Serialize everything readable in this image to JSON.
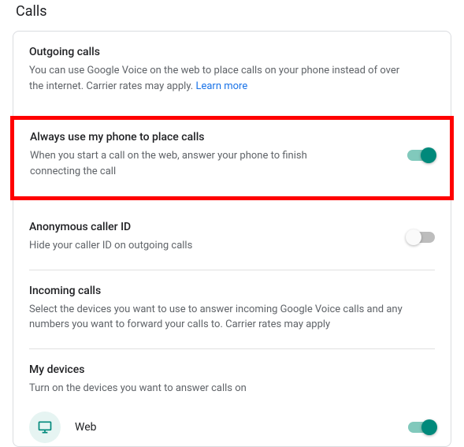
{
  "page_title": "Calls",
  "outgoing": {
    "title": "Outgoing calls",
    "desc": "You can use Google Voice on the web to place calls on your phone instead of over the internet. Carrier rates may apply. ",
    "learn_more": "Learn more"
  },
  "always_phone": {
    "title": "Always use my phone to place calls",
    "desc": "When you start a call on the web, answer your phone to finish connecting the call",
    "enabled": true
  },
  "anonymous": {
    "title": "Anonymous caller ID",
    "desc": "Hide your caller ID on outgoing calls",
    "enabled": false
  },
  "incoming": {
    "title": "Incoming calls",
    "desc": "Select the devices you want to use to answer incoming Google Voice calls and any numbers you want to forward your calls to. Carrier rates may apply"
  },
  "devices": {
    "title": "My devices",
    "desc": "Turn on the devices you want to answer calls on",
    "items": [
      {
        "label": "Web",
        "enabled": true
      }
    ]
  },
  "colors": {
    "accent": "#00897b",
    "link": "#1a73e8",
    "highlight": "#ff0000"
  }
}
